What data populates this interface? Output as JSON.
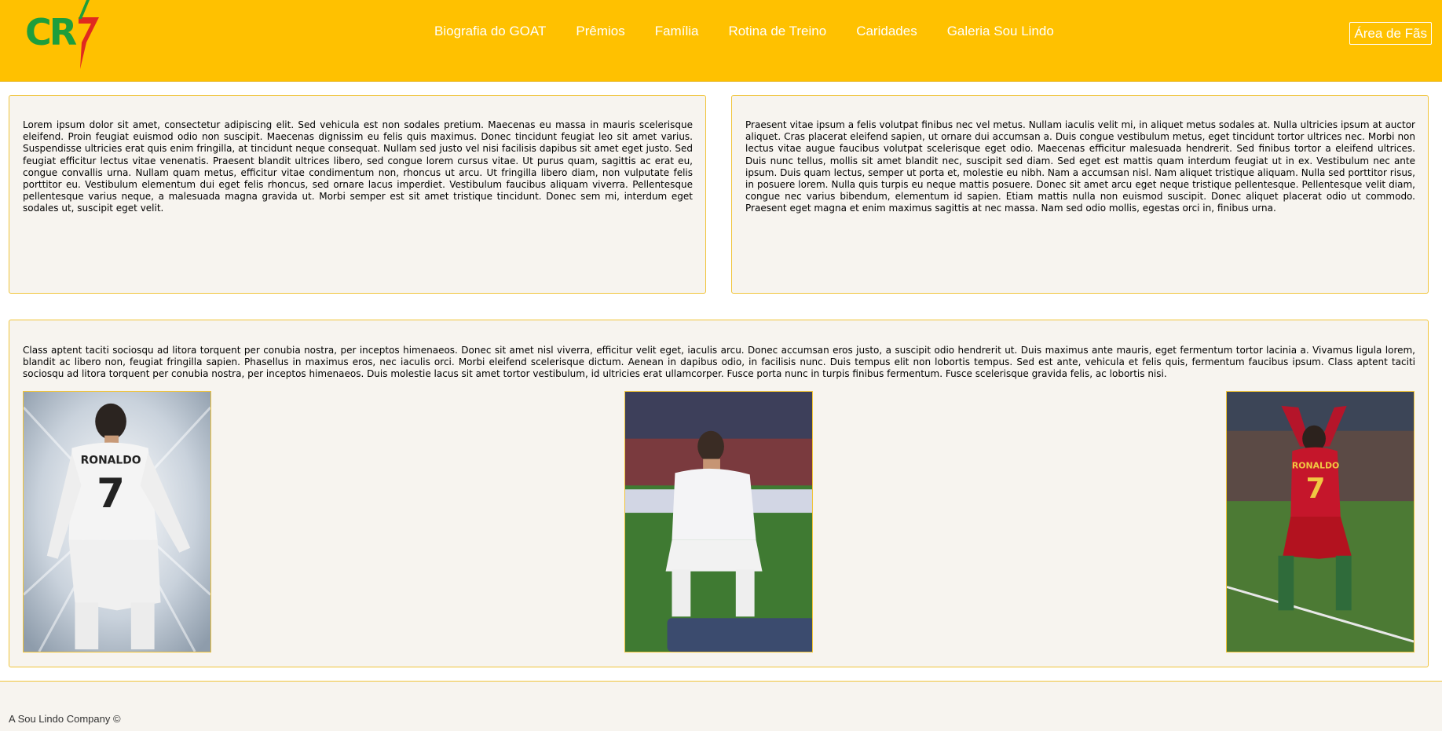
{
  "header": {
    "logo_text": "CR7",
    "brand_colors": {
      "background": "#FFC100",
      "logo_green": "#1E9E3C",
      "logo_red": "#E02A1F"
    },
    "nav": [
      {
        "label": "Biografia do GOAT"
      },
      {
        "label": "Prêmios"
      },
      {
        "label": "Família"
      },
      {
        "label": "Rotina de Treino"
      },
      {
        "label": "Caridades"
      },
      {
        "label": "Galeria Sou Lindo"
      }
    ],
    "fan_area_label": "Área de Fãs"
  },
  "main": {
    "paragraph1": "Lorem ipsum dolor sit amet, consectetur adipiscing elit. Sed vehicula est non sodales pretium. Maecenas eu massa in mauris scelerisque eleifend. Proin feugiat euismod odio non suscipit. Maecenas dignissim eu felis quis maximus. Donec tincidunt feugiat leo sit amet varius. Suspendisse ultricies erat quis enim fringilla, at tincidunt neque consequat. Nullam sed justo vel nisi facilisis dapibus sit amet eget justo. Sed feugiat efficitur lectus vitae venenatis. Praesent blandit ultrices libero, sed congue lorem cursus vitae. Ut purus quam, sagittis ac erat eu, congue convallis urna. Nullam quam metus, efficitur vitae condimentum non, rhoncus ut arcu. Ut fringilla libero diam, non vulputate felis porttitor eu. Vestibulum elementum dui eget felis rhoncus, sed ornare lacus imperdiet. Vestibulum faucibus aliquam viverra. Pellentesque pellentesque varius neque, a malesuada magna gravida ut. Morbi semper est sit amet tristique tincidunt. Donec sem mi, interdum eget sodales ut, suscipit eget velit.",
    "paragraph2": "Praesent vitae ipsum a felis volutpat finibus nec vel metus. Nullam iaculis velit mi, in aliquet metus sodales at. Nulla ultricies ipsum at auctor aliquet. Cras placerat eleifend sapien, ut ornare dui accumsan a. Duis congue vestibulum metus, eget tincidunt tortor ultrices nec. Morbi non lectus vitae augue faucibus volutpat scelerisque eget odio. Maecenas efficitur malesuada hendrerit. Sed finibus tortor a eleifend ultrices. Duis nunc tellus, mollis sit amet blandit nec, suscipit sed diam. Sed eget est mattis quam interdum feugiat ut in ex. Vestibulum nec ante ipsum. Duis quam lectus, semper ut porta et, molestie eu nibh. Nam a accumsan nisl. Nam aliquet tristique aliquam. Nulla sed porttitor risus, in posuere lorem. Nulla quis turpis eu neque mattis posuere. Donec sit amet arcu eget neque tristique pellentesque. Pellentesque velit diam, congue nec varius bibendum, elementum id sapien. Etiam mattis nulla non euismod suscipit. Donec aliquet placerat odio ut commodo. Praesent eget magna et enim maximus sagittis at nec massa. Nam sed odio mollis, egestas orci in, finibus urna.",
    "paragraph3": "Class aptent taciti sociosqu ad litora torquent per conubia nostra, per inceptos himenaeos. Donec sit amet nisl viverra, efficitur velit eget, iaculis arcu. Donec accumsan eros justo, a suscipit odio hendrerit ut. Duis maximus ante mauris, eget fermentum tortor lacinia a. Vivamus ligula lorem, blandit ac libero non, feugiat fringilla sapien. Phasellus in maximus eros, nec iaculis orci. Morbi eleifend scelerisque dictum. Aenean in dapibus odio, in facilisis nunc. Duis tempus elit non lobortis tempus. Sed est ante, vehicula et felis quis, fermentum faucibus ipsum. Class aptent taciti sociosqu ad litora torquent per conubia nostra, per inceptos himenaeos. Duis molestie lacus sit amet tortor vestibulum, id ultricies erat ullamcorper. Fusce porta nunc in turpis finibus fermentum. Fusce scelerisque gravida felis, ac lobortis nisi.",
    "photos": [
      {
        "jersey_name": "RONALDO",
        "number": "7"
      },
      {
        "jersey_name": "",
        "number": ""
      },
      {
        "jersey_name": "RONALDO",
        "number": "7"
      }
    ]
  },
  "footer": {
    "text": "A Sou Lindo Company ©"
  }
}
